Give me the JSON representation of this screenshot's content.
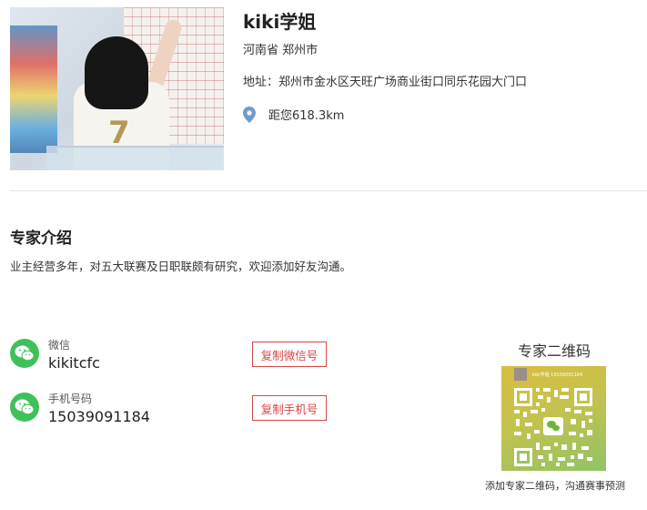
{
  "expert": {
    "name": "kiki学姐",
    "region": "河南省 郑州市",
    "address": "地址：郑州市金水区天旺广场商业街口同乐花园大门口",
    "distance": "距您618.3km"
  },
  "intro": {
    "title": "专家介绍",
    "text": "业主经营多年，对五大联赛及日职联颇有研究，欢迎添加好友沟通。"
  },
  "contacts": {
    "wechat": {
      "label": "微信",
      "value": "kikitcfc",
      "copy_label": "复制微信号"
    },
    "phone": {
      "label": "手机号码",
      "value": "15039091184",
      "copy_label": "复制手机号"
    }
  },
  "qr": {
    "title": "专家二维码",
    "caption": "添加专家二维码，沟通赛事预测",
    "header_text": "kiki学姐 15039091184"
  },
  "colors": {
    "accent_red": "#d94545",
    "wechat_green": "#3fc15a",
    "pin_blue": "#6d9cc7"
  },
  "icons": {
    "pin": "location-pin-icon",
    "wechat": "wechat-icon"
  }
}
